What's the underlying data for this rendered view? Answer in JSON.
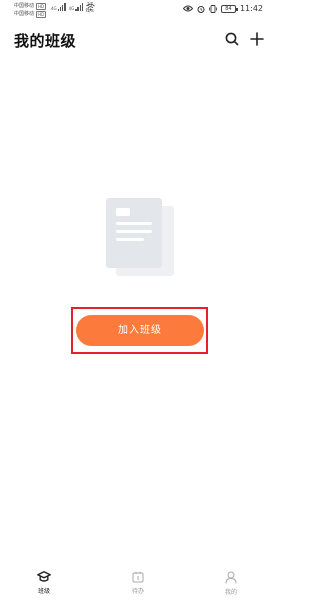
{
  "status_bar": {
    "carrier_1": "中国移动",
    "carrier_1_tag": "HD",
    "carrier_2": "中国移动",
    "carrier_2_tag": "HD",
    "network_type_1": "4G",
    "network_type_2": "4G",
    "speed_value": "27",
    "speed_unit": "B/s",
    "battery": "84",
    "time": "11:42"
  },
  "header": {
    "title": "我的班级",
    "search_icon": "search-icon",
    "add_icon": "plus-icon"
  },
  "empty_state": {
    "illustration": "document-icon",
    "join_button_label": "加入班级",
    "highlight_color": "#e0222c",
    "button_color": "#fb7a3c"
  },
  "bottom_nav": {
    "items": [
      {
        "label": "班级",
        "icon": "graduation-cap-icon",
        "active": true
      },
      {
        "label": "待办",
        "icon": "todo-calendar-icon",
        "active": false
      },
      {
        "label": "我的",
        "icon": "person-icon",
        "active": false
      }
    ]
  }
}
